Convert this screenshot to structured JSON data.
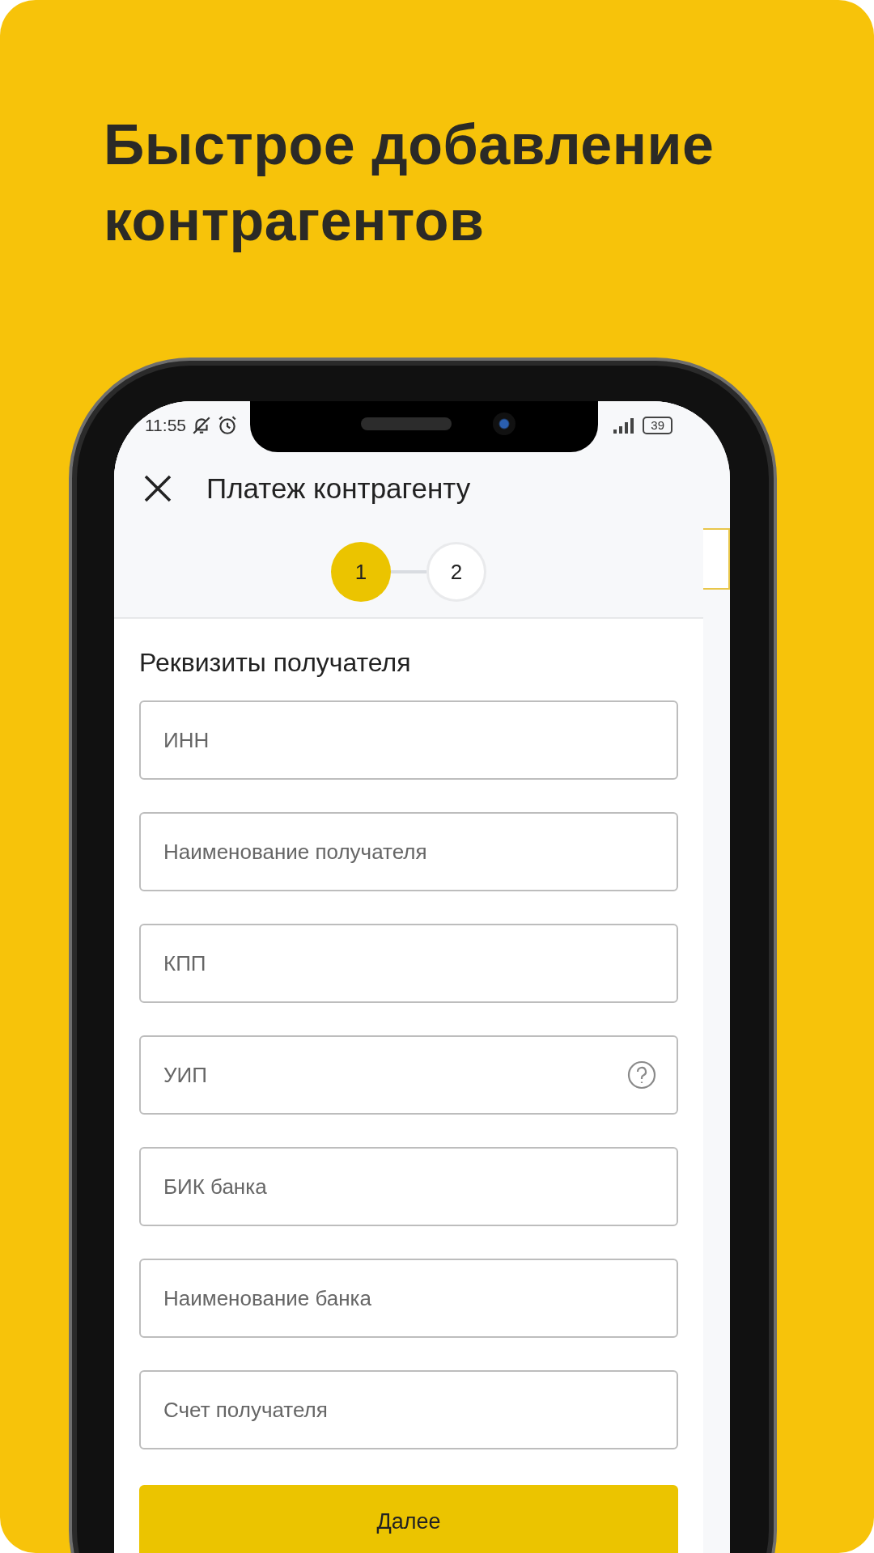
{
  "headline": [
    "Быстрое добавление",
    "контрагентов"
  ],
  "status_bar": {
    "time": "11:55",
    "battery": "39"
  },
  "header": {
    "title": "Платеж контрагенту"
  },
  "stepper": [
    {
      "label": "1",
      "selected": true
    },
    {
      "label": "2",
      "selected": false
    }
  ],
  "section_title": "Реквизиты получателя",
  "fields": [
    {
      "placeholder": "ИНН",
      "help": false
    },
    {
      "placeholder": "Наименование получателя",
      "help": false
    },
    {
      "placeholder": "КПП",
      "help": false
    },
    {
      "placeholder": "УИП",
      "help": true
    },
    {
      "placeholder": "БИК банка",
      "help": false
    },
    {
      "placeholder": "Наименование банка",
      "help": false
    },
    {
      "placeholder": "Счет получателя",
      "help": false
    }
  ],
  "button": "Далее"
}
